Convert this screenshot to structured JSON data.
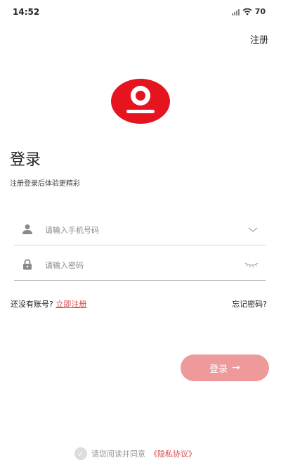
{
  "status_bar": {
    "time": "14:52",
    "battery": "70"
  },
  "header": {
    "register_link": "注册"
  },
  "login": {
    "title": "登录",
    "subtitle": "注册登录后体验更精彩",
    "phone_placeholder": "请输入手机号码",
    "password_placeholder": "请输入密码",
    "no_account_text": "还没有账号?",
    "register_now": "立即注册",
    "forgot_password": "忘记密码?",
    "submit_label": "登录",
    "submit_arrow": "→"
  },
  "agreement": {
    "text": "请您阅读并同意",
    "policy_link": "《隐私协议》"
  },
  "colors": {
    "brand_red": "#e5141f",
    "button_pink": "#ef9a9a",
    "link_red": "#d9484a"
  }
}
